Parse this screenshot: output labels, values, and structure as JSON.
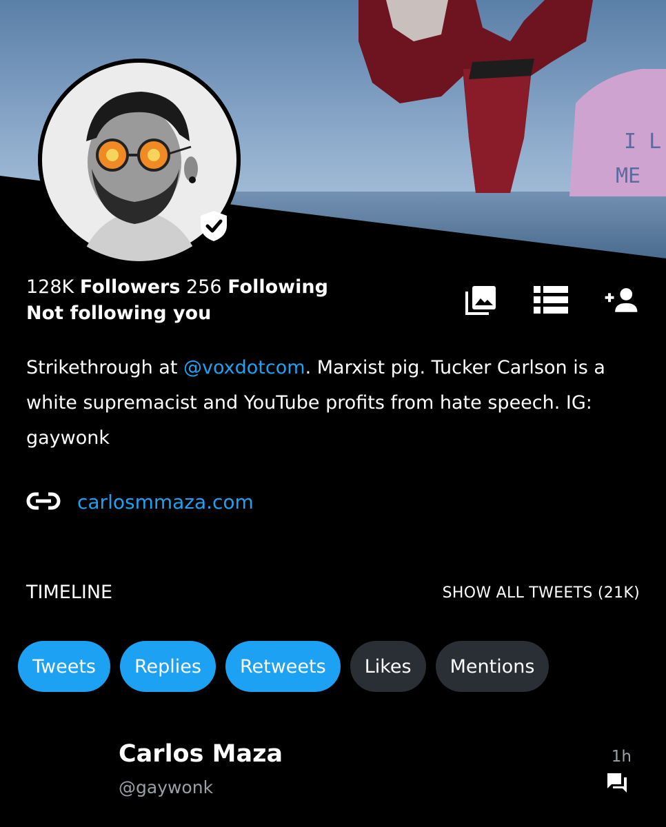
{
  "profile": {
    "followers_count": "128K",
    "followers_label": "Followers",
    "following_count": "256",
    "following_label": "Following",
    "relationship": "Not following you",
    "bio_before": "Strikethrough at ",
    "bio_mention": "@voxdotcom",
    "bio_after": ". Marxist pig. Tucker Carlson is a white supremacist and YouTube profits from hate speech. IG: gaywonk",
    "website": "carlosmmaza.com"
  },
  "actions": {
    "icons": [
      "media-icon",
      "list-icon",
      "add-user-icon"
    ]
  },
  "timeline": {
    "label": "TIMELINE",
    "show_all": "SHOW ALL TWEETS (21K)",
    "filters": [
      {
        "label": "Tweets",
        "active": true
      },
      {
        "label": "Replies",
        "active": true
      },
      {
        "label": "Retweets",
        "active": true
      },
      {
        "label": "Likes",
        "active": false
      },
      {
        "label": "Mentions",
        "active": false
      }
    ]
  },
  "tweet": {
    "name": "Carlos Maza",
    "handle": "@gaywonk",
    "time": "1h"
  },
  "banner_text": [
    "I L",
    "ME"
  ],
  "colors": {
    "accent": "#1da1f2",
    "chip_inactive": "#2a2f35",
    "background": "#000000"
  }
}
